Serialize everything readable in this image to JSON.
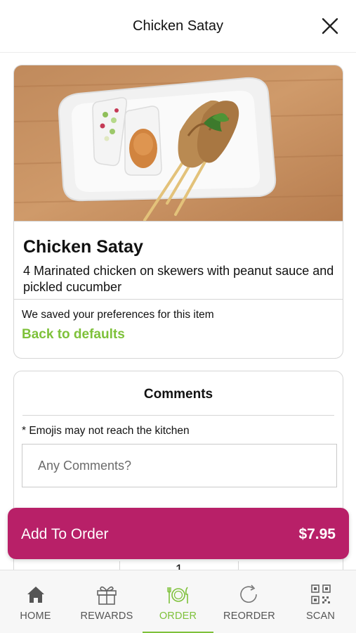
{
  "header": {
    "title": "Chicken Satay"
  },
  "item": {
    "name": "Chicken Satay",
    "description": "4 Marinated chicken on skewers with peanut sauce and pickled cucumber",
    "preferences_note": "We saved your preferences for this item",
    "back_to_defaults": "Back to defaults"
  },
  "comments": {
    "title": "Comments",
    "note": "* Emojis may not reach the kitchen",
    "placeholder": "Any Comments?",
    "value": ""
  },
  "quantity": {
    "value": "1"
  },
  "order_bar": {
    "label": "Add To Order",
    "price": "$7.95"
  },
  "nav": {
    "items": [
      {
        "label": "HOME",
        "icon": "home-icon",
        "active": false
      },
      {
        "label": "REWARDS",
        "icon": "gift-icon",
        "active": false
      },
      {
        "label": "ORDER",
        "icon": "plate-cutlery-icon",
        "active": true
      },
      {
        "label": "REORDER",
        "icon": "refresh-icon",
        "active": false
      },
      {
        "label": "SCAN",
        "icon": "qr-code-icon",
        "active": false
      }
    ]
  },
  "colors": {
    "accent_green": "#7ec13a",
    "order_bar": "#b82068",
    "nav_bg": "#f7f7f7"
  }
}
